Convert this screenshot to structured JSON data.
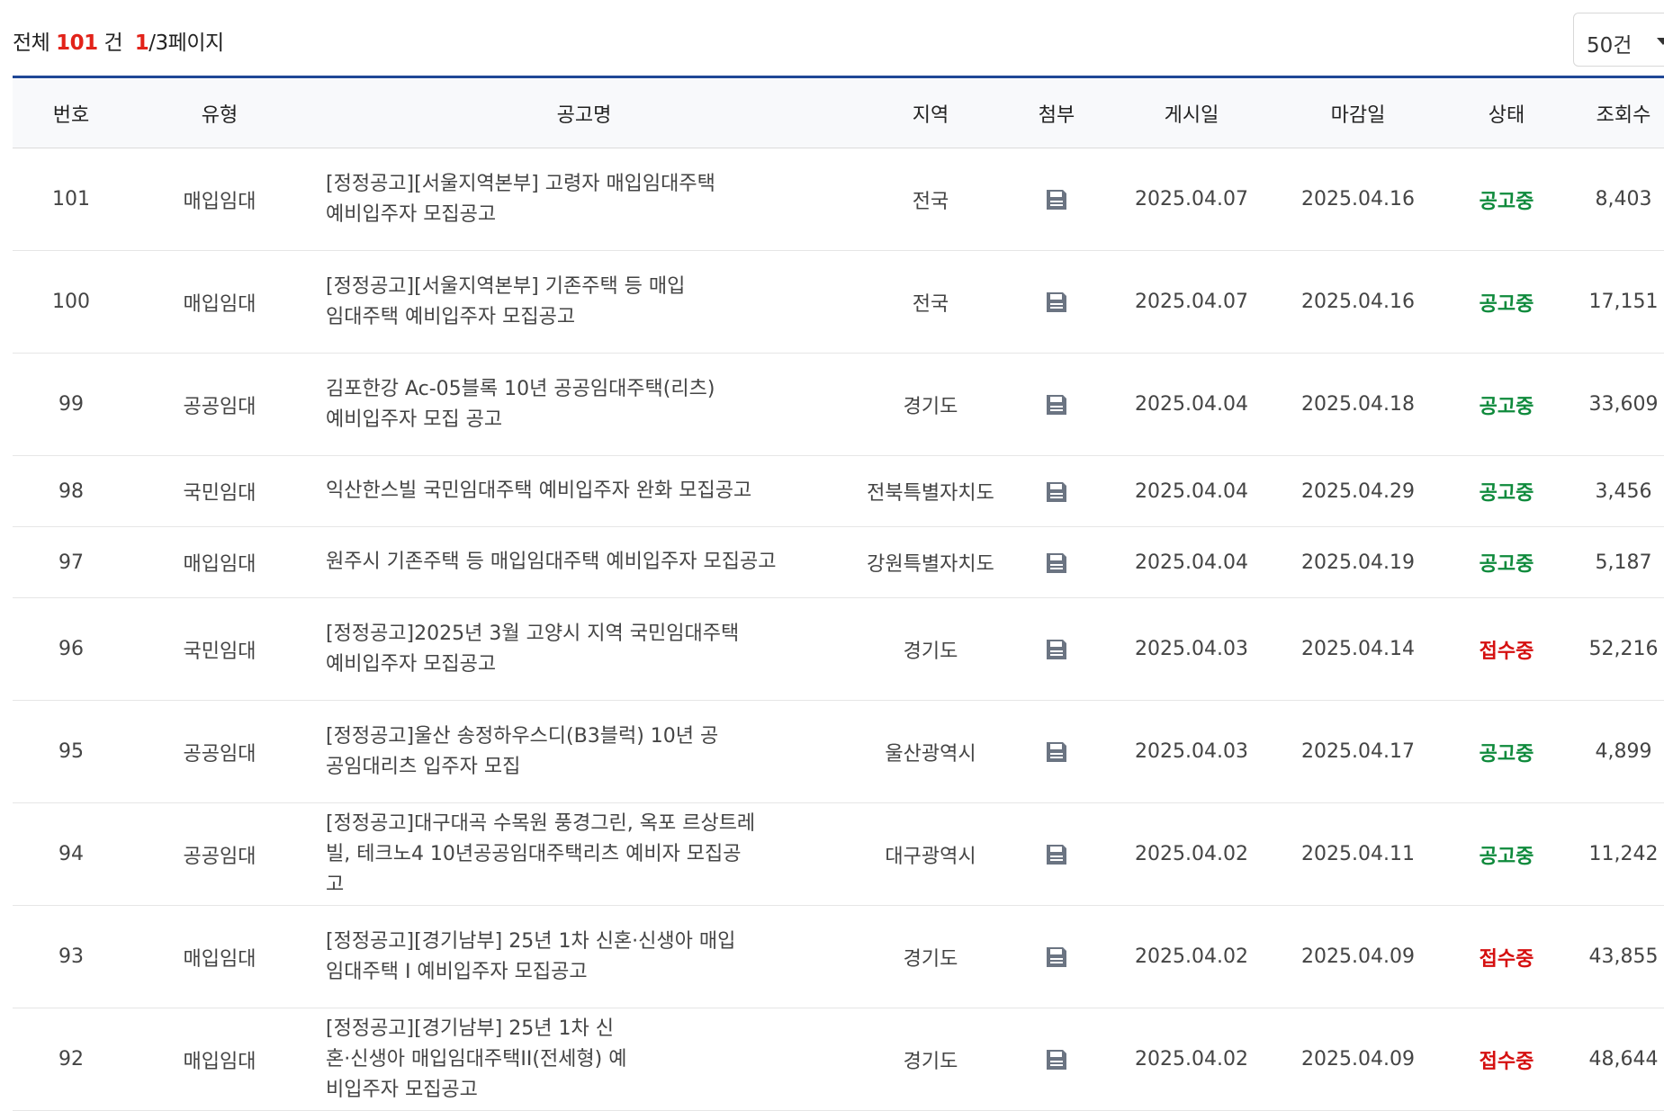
{
  "summary": {
    "prefix": "전체",
    "total": "101",
    "unit": "건",
    "page_current": "1",
    "page_rest": "/3페이지"
  },
  "page_size": {
    "selected": "50건"
  },
  "table": {
    "headers": [
      "번호",
      "유형",
      "공고명",
      "지역",
      "첨부",
      "게시일",
      "마감일",
      "상태",
      "조회수"
    ],
    "rows": [
      {
        "no": "101",
        "type": "매입임대",
        "title": "[정정공고][서울지역본부] 고령자 매입임대주택 예비입주자 모집공고",
        "region": "전국",
        "posted": "2025.04.07",
        "deadline": "2025.04.16",
        "status": "공고중",
        "views": "8,403"
      },
      {
        "no": "100",
        "type": "매입임대",
        "title": "[정정공고][서울지역본부] 기존주택 등 매입임대주택 예비입주자 모집공고",
        "region": "전국",
        "posted": "2025.04.07",
        "deadline": "2025.04.16",
        "status": "공고중",
        "views": "17,151"
      },
      {
        "no": "99",
        "type": "공공임대",
        "title": "김포한강 Ac-05블록 10년 공공임대주택(리츠) 예비입주자 모집 공고",
        "region": "경기도",
        "posted": "2025.04.04",
        "deadline": "2025.04.18",
        "status": "공고중",
        "views": "33,609"
      },
      {
        "no": "98",
        "type": "국민임대",
        "title": "익산한스빌 국민임대주택 예비입주자 완화 모집공고",
        "region": "전북특별자치도",
        "posted": "2025.04.04",
        "deadline": "2025.04.29",
        "status": "공고중",
        "views": "3,456"
      },
      {
        "no": "97",
        "type": "매입임대",
        "title": "원주시 기존주택 등 매입임대주택 예비입주자 모집공고",
        "region": "강원특별자치도",
        "posted": "2025.04.04",
        "deadline": "2025.04.19",
        "status": "공고중",
        "views": "5,187"
      },
      {
        "no": "96",
        "type": "국민임대",
        "title": "[정정공고]2025년 3월 고양시 지역 국민임대주택 예비입주자 모집공고",
        "region": "경기도",
        "posted": "2025.04.03",
        "deadline": "2025.04.14",
        "status": "접수중",
        "views": "52,216"
      },
      {
        "no": "95",
        "type": "공공임대",
        "title": "[정정공고]울산 송정하우스디(B3블럭) 10년 공공임대리츠 입주자 모집",
        "region": "울산광역시",
        "posted": "2025.04.03",
        "deadline": "2025.04.17",
        "status": "공고중",
        "views": "4,899"
      },
      {
        "no": "94",
        "type": "공공임대",
        "title": "[정정공고]대구대곡 수목원 풍경그린, 옥포 르상트레빌, 테크노4 10년공공임대주택리츠 예비자 모집공고",
        "region": "대구광역시",
        "posted": "2025.04.02",
        "deadline": "2025.04.11",
        "status": "공고중",
        "views": "11,242"
      },
      {
        "no": "93",
        "type": "매입임대",
        "title": "[정정공고][경기남부] 25년 1차 신혼·신생아 매입임대주택 Ⅰ 예비입주자 모집공고",
        "region": "경기도",
        "posted": "2025.04.02",
        "deadline": "2025.04.09",
        "status": "접수중",
        "views": "43,855"
      },
      {
        "no": "92",
        "type": "매입임대",
        "title": "[정정공고][경기남부] 25년 1차 신혼·신생아 매입임대주택ⅠⅠ(전세형) 예비입주자 모집공고",
        "region": "경기도",
        "posted": "2025.04.02",
        "deadline": "2025.04.09",
        "status": "접수중",
        "views": "48,644"
      }
    ]
  },
  "icons": {
    "attachment": "file-save-icon"
  },
  "colors": {
    "accent": "#1f4796",
    "status_open": "#0f8a3c",
    "status_received": "#d50f0f",
    "count_highlight": "#e2231a"
  }
}
